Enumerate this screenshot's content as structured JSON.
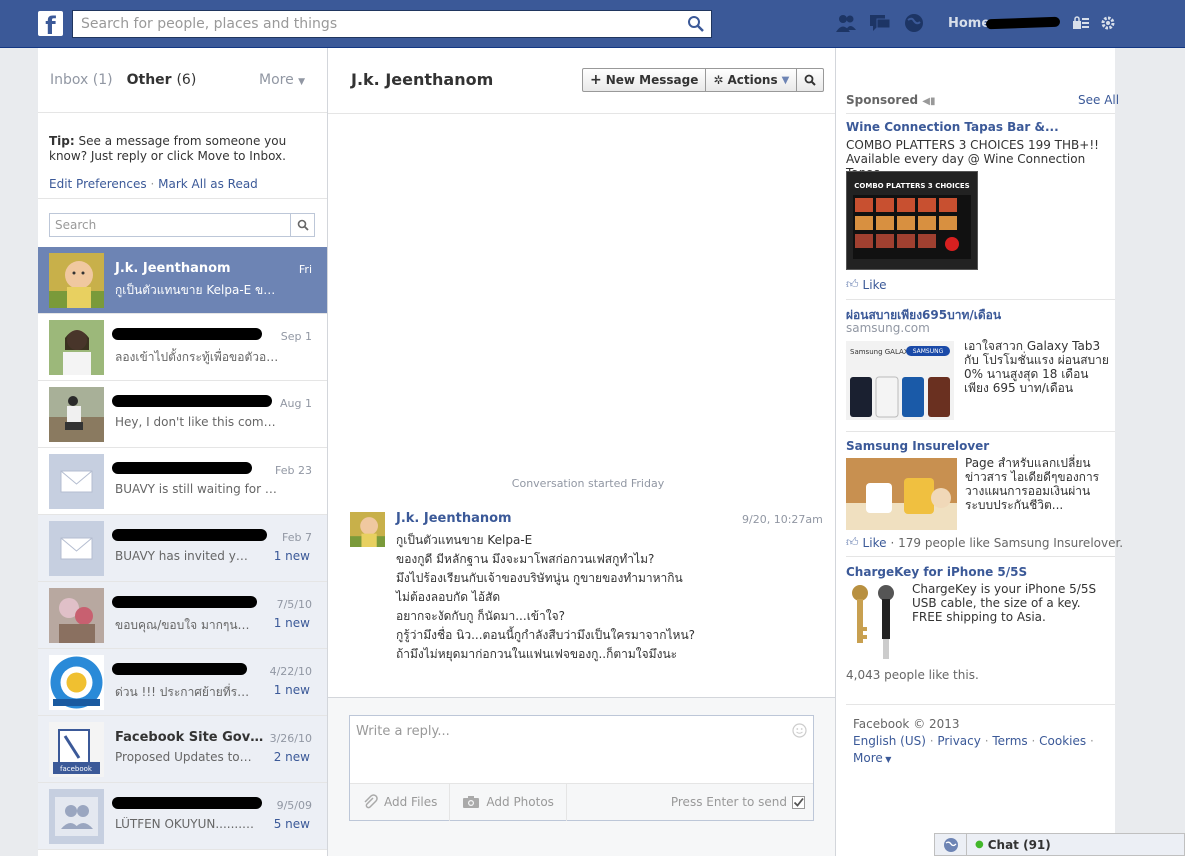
{
  "topbar": {
    "logo": "f",
    "search_placeholder": "Search for people, places and things",
    "home_label": "Home"
  },
  "folders": {
    "inbox_label": "Inbox",
    "inbox_count": "(1)",
    "other_label": "Other",
    "other_count": "(6)",
    "more_label": "More"
  },
  "tip": {
    "bold": "Tip:",
    "text": "See a message from someone you know? Just reply or click Move to Inbox.",
    "edit_prefs": "Edit Preferences",
    "separator": "·",
    "mark_all": "Mark All as Read"
  },
  "left_search": {
    "placeholder": "Search"
  },
  "threads": [
    {
      "name": "J.k. Jeenthanom",
      "date": "Fri",
      "snippet": "กูเป็นตัวแทนขาย Kelpa-E ของ...",
      "new": ""
    },
    {
      "name": "",
      "date": "Sep 1",
      "snippet": "ลองเข้าไปตั้งกระทู้เพื่อขอตัวอย่...",
      "new": ""
    },
    {
      "name": "",
      "date": "Aug 1",
      "snippet": "Hey, I don't like this comme...",
      "new": ""
    },
    {
      "name": "",
      "date": "Feb 23",
      "snippet": "BUAVY is still waiting for yo...",
      "new": ""
    },
    {
      "name": "",
      "date": "Feb 7",
      "snippet": "BUAVY has invited you to j...",
      "new": "1 new"
    },
    {
      "name": "",
      "date": "7/5/10",
      "snippet": "ขอบคุณ/ขอบใจ มากๆนะครับ...",
      "new": "1 new"
    },
    {
      "name": "",
      "date": "4/22/10",
      "snippet": "ด่วน !!! ประกาศย้ายที่รวมพลช่...",
      "new": "1 new"
    },
    {
      "name": "Facebook Site Gove...",
      "date": "3/26/10",
      "snippet": "Proposed Updates to Faceb...",
      "new": "2 new"
    },
    {
      "name": "",
      "date": "9/5/09",
      "snippet": "LÜTFEN OKUYUN........ • S...",
      "new": "5 new"
    }
  ],
  "conversation": {
    "title": "J.k. Jeenthanom",
    "new_message_label": "New Message",
    "actions_label": "Actions",
    "started": "Conversation started Friday",
    "author": "J.k. Jeenthanom",
    "time": "9/20, 10:27am",
    "lines": [
      "กูเป็นตัวแทนขาย Kelpa-E",
      "ของกูดี มีหลักฐาน มึงจะมาโพสก่อกวนเฟสกูทำไม?",
      "มึงไปร้องเรียนกับเจ้าของบริษัทนู่น กูขายของทำมาหากิน",
      "ไม่ต้องลอบกัด ไอ้สัด",
      "อยากจะงัดกับกู ก็นัดมา...เข้าใจ?",
      "กูรู้ว่ามึงชื่อ นิว...ตอนนี้กูกำลังสืบว่ามึงเป็นใครมาจากไหน?",
      "ถ้ามึงไม่หยุดมาก่อกวนในแฟนเฟจของกู..ก็ตามใจมึงนะ"
    ],
    "reply_placeholder": "Write a reply...",
    "add_files": "Add Files",
    "add_photos": "Add Photos",
    "press_enter": "Press Enter to send"
  },
  "sidebar": {
    "sponsored": "Sponsored",
    "see_all": "See All",
    "ads": [
      {
        "title": "Wine Connection Tapas Bar &...",
        "line1": "COMBO PLATTERS 3 CHOICES 199 THB+!!",
        "line2": "Available every day @ Wine Connection Tapas...",
        "image_caption": "COMBO PLATTERS 3 CHOICES",
        "like": "Like"
      },
      {
        "title": "ผ่อนสบายเพียง695บาท/เดือน",
        "sub": "samsung.com",
        "text": "เอาใจสาวก Galaxy Tab3 กับ โปรโมชั่นแรง ผ่อนสบาย 0% นานสูงสุด 18 เดือน เพียง 695 บาท/เดือน",
        "image_text": "Samsung GALAXY S4",
        "brand": "SAMSUNG"
      },
      {
        "title": "Samsung Insurelover",
        "text": "Page สำหรับแลกเปลี่ยน ข่าวสาร ไอเดียดีๆของการ วางแผนการออมเงินผ่าน ระบบประกันชีวิต...",
        "like": "Like",
        "like_rest": "· 179 people like Samsung Insurelover."
      },
      {
        "title": "ChargeKey for iPhone 5/5S",
        "text": "ChargeKey is your iPhone 5/5S USB cable, the size of a key. FREE shipping to Asia.",
        "likes": "4,043 people like this."
      }
    ],
    "footer": {
      "copyright": "Facebook © 2013",
      "lang": "English (US)",
      "privacy": "Privacy",
      "terms": "Terms",
      "cookies": "Cookies",
      "more": "More"
    }
  },
  "chat": {
    "label": "Chat (91)"
  },
  "colors": {
    "brand": "#3b5998",
    "selected": "#6d84b4",
    "unread_bg": "#eceff5"
  }
}
